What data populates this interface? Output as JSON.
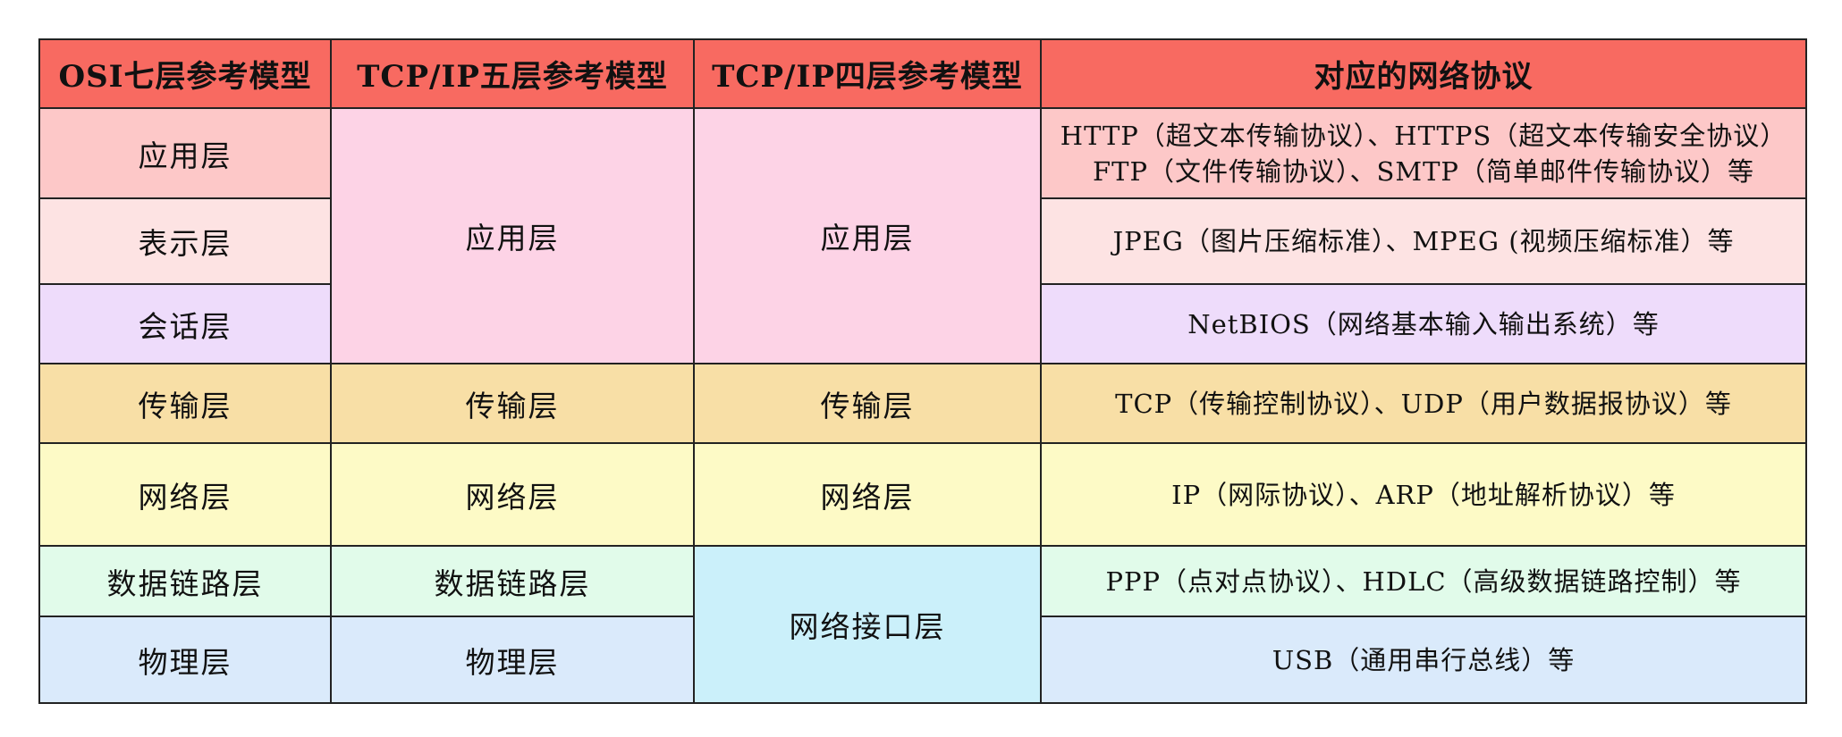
{
  "headers": {
    "osi7": "OSI七层参考模型",
    "tcpip5": "TCP/IP五层参考模型",
    "tcpip4": "TCP/IP四层参考模型",
    "protocols": "对应的网络协议"
  },
  "rows": [
    {
      "osi": "应用层",
      "protocols": [
        "HTTP（超文本传输协议）、HTTPS（超文本传输安全协议）",
        "FTP（文件传输协议）、SMTP（简单邮件传输协议）等"
      ]
    },
    {
      "osi": "表示层",
      "protocols": [
        "JPEG（图片压缩标准）、MPEG (视频压缩标准）等"
      ]
    },
    {
      "osi": "会话层",
      "protocols": [
        "NetBIOS（网络基本输入输出系统）等"
      ]
    },
    {
      "osi": "传输层",
      "protocols": [
        "TCP（传输控制协议）、UDP（用户数据报协议）等"
      ]
    },
    {
      "osi": "网络层",
      "protocols": [
        "IP（网际协议）、ARP（地址解析协议）等"
      ]
    },
    {
      "osi": "数据链路层",
      "protocols": [
        "PPP（点对点协议）、HDLC（高级数据链路控制）等"
      ]
    },
    {
      "osi": "物理层",
      "protocols": [
        "USB（通用串行总线）等"
      ]
    }
  ],
  "tcpip5": {
    "application": "应用层",
    "transport": "传输层",
    "network": "网络层",
    "datalink": "数据链路层",
    "physical": "物理层"
  },
  "tcpip4": {
    "application": "应用层",
    "transport": "传输层",
    "network": "网络层",
    "network_interface": "网络接口层"
  },
  "colors": {
    "header": "#f86a61",
    "application": "#fdc8c8",
    "presentation": "#fde3e3",
    "session": "#eedcfb",
    "merged_application": "#fdd3e6",
    "transport": "#f8dfa6",
    "network": "#fdfac6",
    "datalink": "#e1fbea",
    "physical": "#daeafb",
    "network_interface": "#cbf0fa",
    "border": "#222222"
  }
}
